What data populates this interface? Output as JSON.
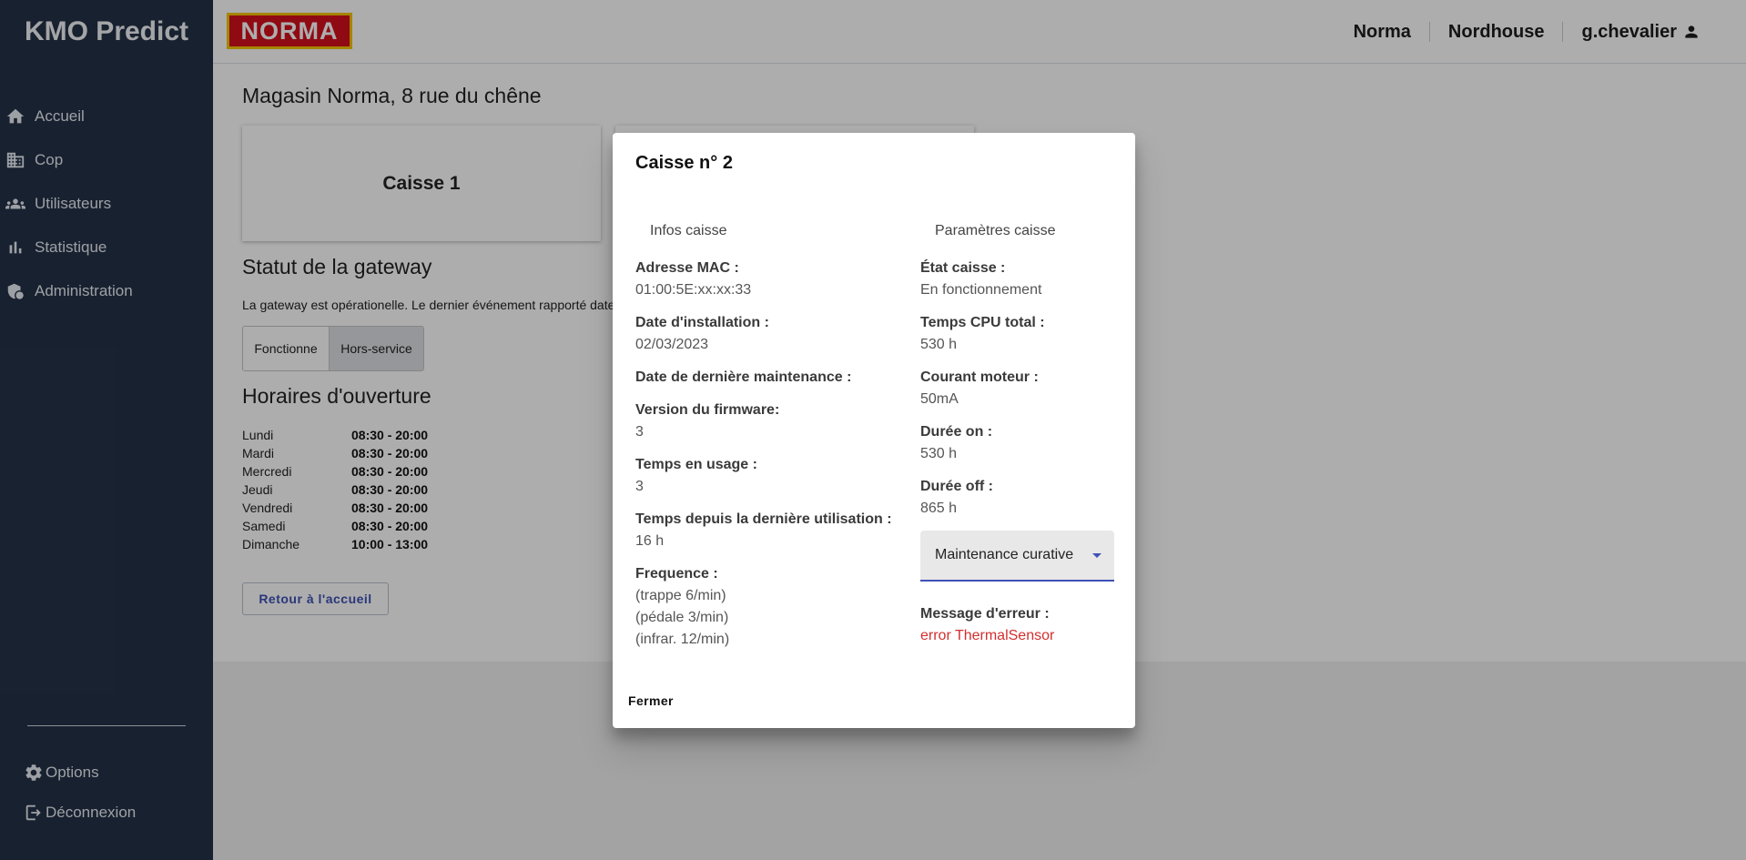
{
  "app": {
    "title": "KMO Predict"
  },
  "sidebar": {
    "items": [
      {
        "label": "Accueil",
        "icon": "home-icon"
      },
      {
        "label": "Cop",
        "icon": "building-icon"
      },
      {
        "label": "Utilisateurs",
        "icon": "users-icon"
      },
      {
        "label": "Statistique",
        "icon": "bar-chart-icon"
      },
      {
        "label": "Administration",
        "icon": "admin-shield-icon"
      }
    ],
    "options_label": "Options",
    "logout_label": "Déconnexion"
  },
  "header": {
    "logo_text": "NORMA",
    "links": [
      "Norma",
      "Nordhouse",
      "g.chevalier"
    ]
  },
  "main": {
    "store_title": "Magasin Norma, 8 rue du chêne",
    "cards": [
      "Caisse 1",
      "",
      ""
    ],
    "gateway_title": "Statut de la gateway",
    "gateway_text": "La gateway est opérationelle. Le dernier événement rapporté date",
    "toggle": {
      "left": "Fonctionne",
      "right": "Hors-service",
      "selected": "Hors-service"
    },
    "hours_title": "Horaires d'ouverture",
    "hours": [
      {
        "day": "Lundi",
        "time": "08:30 - 20:00"
      },
      {
        "day": "Mardi",
        "time": "08:30 - 20:00"
      },
      {
        "day": "Mercredi",
        "time": "08:30 - 20:00"
      },
      {
        "day": "Jeudi",
        "time": "08:30 - 20:00"
      },
      {
        "day": "Vendredi",
        "time": "08:30 - 20:00"
      },
      {
        "day": "Samedi",
        "time": "08:30 - 20:00"
      },
      {
        "day": "Dimanche",
        "time": "10:00 - 13:00"
      }
    ],
    "back_button": "Retour à l'accueil"
  },
  "dialog": {
    "title": "Caisse n° 2",
    "infos_header": "Infos caisse",
    "params_header": "Paramètres caisse",
    "mac_label": "Adresse MAC :",
    "mac_value": "01:00:5E:xx:xx:33",
    "install_label": "Date d'installation :",
    "install_value": "02/03/2023",
    "maint_label": "Date de dernière maintenance :",
    "firmware_label": "Version du firmware:",
    "firmware_value": "3",
    "usage_label": "Temps en usage :",
    "usage_value": "3",
    "since_label": "Temps depuis la dernière utilisation :",
    "since_value": "16 h",
    "freq_label": "Frequence :",
    "freq_values": [
      "(trappe 6/min)",
      "(pédale 3/min)",
      "(infrar. 12/min)"
    ],
    "state_label": "État caisse :",
    "state_value": "En fonctionnement",
    "cpu_label": "Temps CPU total :",
    "cpu_value": "530 h",
    "motor_label": "Courant moteur :",
    "motor_value": "50mA",
    "on_label": "Durée on :",
    "on_value": "530 h",
    "off_label": "Durée off :",
    "off_value": "865 h",
    "select_value": "Maintenance curative",
    "error_label": "Message d'erreur :",
    "error_value": "error ThermalSensor",
    "close_label": "Fermer"
  },
  "colors": {
    "sidebar_bg": "#243247",
    "accent": "#3f51b5",
    "error": "#d32f2f",
    "logo_red": "#d4101c",
    "logo_yellow": "#f4c400"
  }
}
